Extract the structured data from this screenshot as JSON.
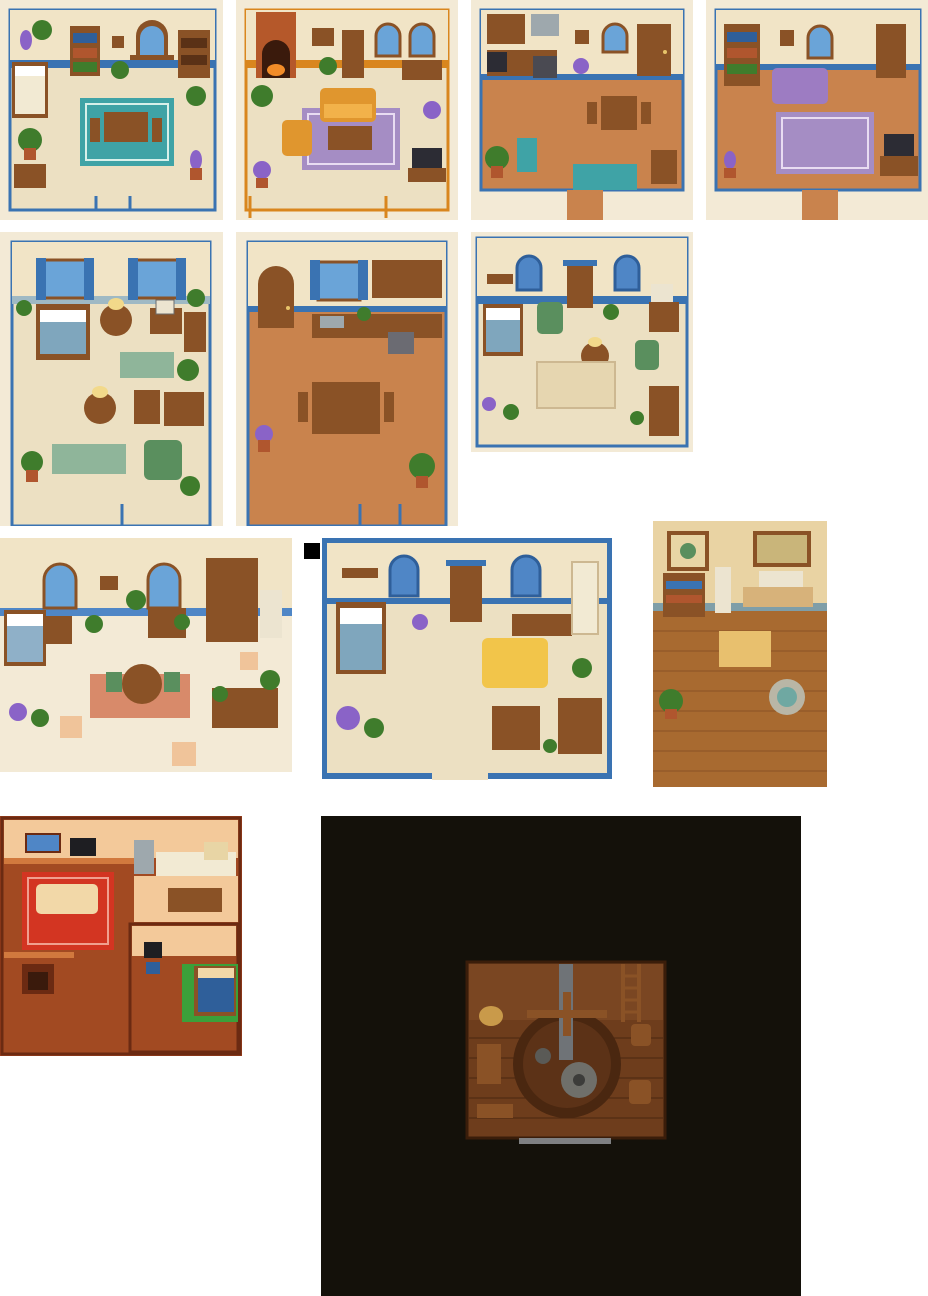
{
  "sheet": {
    "background": "#ffffff",
    "palette": {
      "wall_cream": "#f1e4c6",
      "floor_cream": "#ece0c2",
      "floor_terracotta": "#c9834d",
      "trim_blue": "#3a73b2",
      "trim_orange": "#d9861e",
      "wood": "#8a5226",
      "wood_dark": "#5a3116",
      "rug_teal": "#3fa3a6",
      "rug_purple": "#a58dc4",
      "rug_green": "#8fb59a",
      "rug_red": "#d33522",
      "sofa_orange": "#e0962e",
      "sofa_purple": "#9d7cc2",
      "sofa_yellow": "#f2c54a",
      "plant_green": "#3f7c2c",
      "lavender": "#8a63c7",
      "mill_dark": "#14110a"
    }
  },
  "rooms": [
    {
      "id": "bedroom-living-teal-rug",
      "icons": [
        "bed-icon",
        "bookshelf-icon",
        "window-icon",
        "table-icon",
        "teal-rug-icon",
        "plant-icon",
        "lavender-pot-icon"
      ]
    },
    {
      "id": "living-room-fireplace",
      "icons": [
        "fireplace-icon",
        "window-icon",
        "sofa-icon",
        "armchair-icon",
        "purple-rug-icon",
        "tv-icon",
        "plant-icon"
      ]
    },
    {
      "id": "kitchen-dining",
      "icons": [
        "kitchen-counter-icon",
        "stove-icon",
        "fridge-icon",
        "door-icon",
        "dining-table-icon",
        "rug-icon",
        "plant-icon"
      ]
    },
    {
      "id": "living-room-purple",
      "icons": [
        "bookshelf-icon",
        "sofa-icon",
        "purple-rug-icon",
        "door-icon",
        "tv-icon",
        "lavender-pot-icon"
      ]
    },
    {
      "id": "bedroom-study-green",
      "icons": [
        "bed-icon",
        "window-icon",
        "desk-icon",
        "computer-icon",
        "lamp-icon",
        "armchair-icon",
        "rug-icon",
        "plant-icon"
      ]
    },
    {
      "id": "kitchen-terracotta",
      "icons": [
        "arched-door-icon",
        "window-icon",
        "cabinet-icon",
        "sink-icon",
        "dining-table-icon",
        "plant-icon"
      ]
    },
    {
      "id": "bedroom-blue-windows",
      "icons": [
        "bed-icon",
        "arched-window-icon",
        "door-icon",
        "armchair-icon",
        "round-table-icon",
        "computer-icon",
        "rug-icon"
      ]
    },
    {
      "id": "cottage-open-plan",
      "icons": [
        "bed-icon",
        "arched-window-icon",
        "bookshelf-icon",
        "fridge-icon",
        "round-table-icon",
        "desk-icon",
        "rug-icon",
        "plant-icon"
      ]
    },
    {
      "id": "studio-yellow-sofa",
      "icons": [
        "bed-icon",
        "arched-window-icon",
        "door-icon",
        "kitchen-counter-icon",
        "fridge-icon",
        "sofa-icon",
        "table-icon",
        "dresser-icon"
      ]
    },
    {
      "id": "wooden-study-maps",
      "icons": [
        "map-icon",
        "bookshelf-icon",
        "computer-icon",
        "table-icon",
        "fountain-icon",
        "plant-icon"
      ]
    },
    {
      "id": "apartment-red-rug",
      "icons": [
        "window-icon",
        "tv-icon",
        "kitchen-counter-icon",
        "sofa-icon",
        "red-rug-icon",
        "dining-table-icon",
        "fireplace-icon",
        "computer-icon",
        "bed-icon"
      ]
    },
    {
      "id": "mill-interior",
      "icons": [
        "millstone-icon",
        "gear-icon",
        "ladder-icon",
        "barrel-icon",
        "sack-icon",
        "bench-icon"
      ]
    }
  ]
}
